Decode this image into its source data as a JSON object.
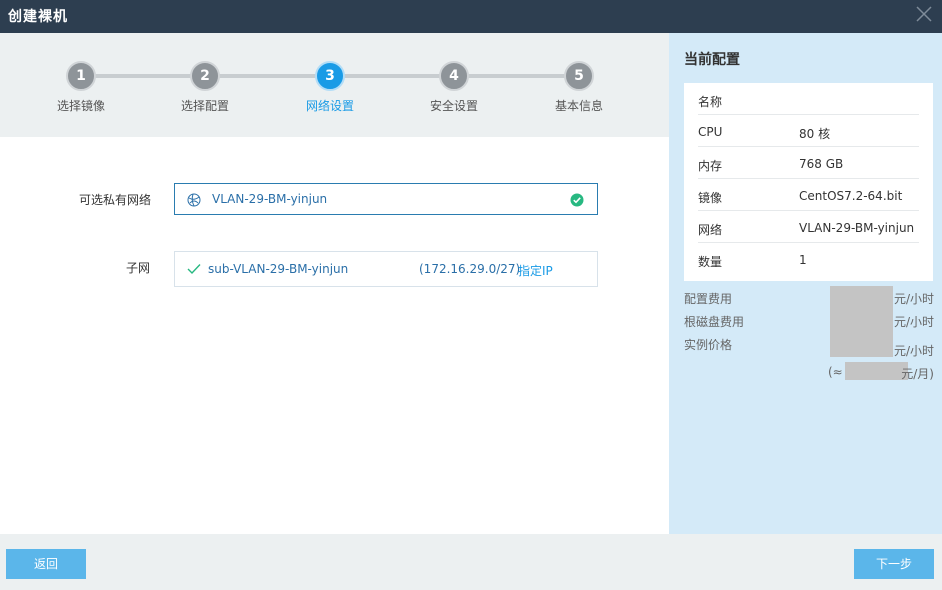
{
  "window": {
    "title": "创建裸机"
  },
  "steps": [
    {
      "num": "1",
      "label": "选择镜像",
      "active": false
    },
    {
      "num": "2",
      "label": "选择配置",
      "active": false
    },
    {
      "num": "3",
      "label": "网络设置",
      "active": true
    },
    {
      "num": "4",
      "label": "安全设置",
      "active": false
    },
    {
      "num": "5",
      "label": "基本信息",
      "active": false
    }
  ],
  "form": {
    "network_label": "可选私有网络",
    "network_value": "VLAN-29-BM-yinjun",
    "subnet_label": "子网",
    "subnet_name": "sub-VLAN-29-BM-yinjun",
    "subnet_cidr": "(172.16.29.0/27)",
    "assign_ip": "指定IP"
  },
  "sidebar": {
    "heading": "当前配置",
    "config": [
      {
        "key": "名称",
        "value": ""
      },
      {
        "key": "CPU",
        "value": "80 核"
      },
      {
        "key": "内存",
        "value": "768 GB"
      },
      {
        "key": "镜像",
        "value": "CentOS7.2-64.bit"
      },
      {
        "key": "网络",
        "value": "VLAN-29-BM-yinjun"
      },
      {
        "key": "数量",
        "value": "1"
      }
    ],
    "fees": {
      "config_fee_label": "配置费用",
      "root_disk_fee_label": "根磁盘费用",
      "instance_price_label": "实例价格",
      "unit_hour": "元/小时",
      "monthly_prefix": "(≈",
      "monthly_suffix": "元/月)"
    }
  },
  "footer": {
    "back_label": "返回",
    "next_label": "下一步"
  },
  "colors": {
    "titlebar": "#2d3e50",
    "accent": "#1a9be6",
    "button": "#5bb6ea",
    "sidebar": "#d4eaf8",
    "success": "#27b881"
  }
}
